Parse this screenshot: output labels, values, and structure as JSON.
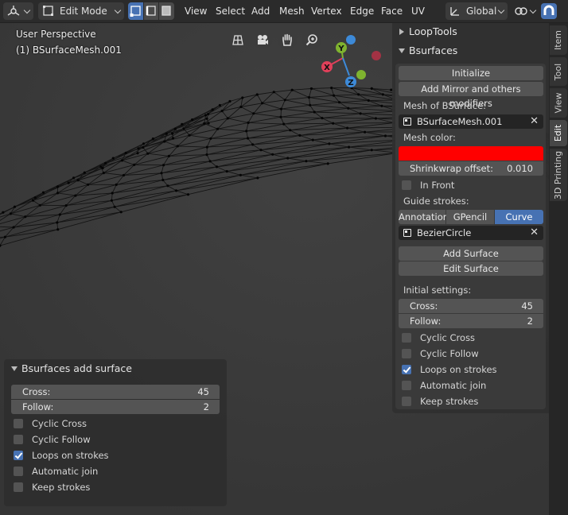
{
  "header": {
    "mode": "Edit Mode",
    "menus": [
      "View",
      "Select",
      "Add",
      "Mesh",
      "Vertex",
      "Edge",
      "Face",
      "UV"
    ],
    "transform_orientation": "Global",
    "icons": [
      "editor-type-icon",
      "vertex-select-icon",
      "edge-select-icon",
      "face-select-icon",
      "orientation-icon",
      "link-icon",
      "snap-magnet-icon"
    ]
  },
  "viewport": {
    "perspective_label": "User Perspective",
    "object_label": "(1) BSurfaceMesh.001",
    "gizmo": {
      "x": "X",
      "y": "Y",
      "z": "Z"
    },
    "nav_icons": [
      "grid-view-icon",
      "camera-icon",
      "pan-hand-icon",
      "zoom-icon"
    ]
  },
  "side_tabs": [
    {
      "label": "Item",
      "active": false
    },
    {
      "label": "Tool",
      "active": false
    },
    {
      "label": "View",
      "active": false
    },
    {
      "label": "Edit",
      "active": true
    },
    {
      "label": "3D Printing",
      "active": false
    }
  ],
  "npanel": {
    "looptools_title": "LoopTools",
    "bsurfaces_title": "Bsurfaces",
    "initialize": "Initialize",
    "add_mirror": "Add Mirror and others modifiers",
    "mesh_label": "Mesh of BSurface:",
    "mesh_value": "BSurfaceMesh.001",
    "color_label": "Mesh color:",
    "mesh_color": "#ff0000",
    "shrinkwrap_label": "Shrinkwrap offset:",
    "shrinkwrap_value": "0.010",
    "in_front": "In Front",
    "guide_label": "Guide strokes:",
    "guide_tabs": [
      {
        "label": "Annotation",
        "active": false
      },
      {
        "label": "GPencil",
        "active": false
      },
      {
        "label": "Curve",
        "active": true
      }
    ],
    "curve_value": "BezierCircle",
    "add_surface": "Add Surface",
    "edit_surface": "Edit Surface",
    "initial_label": "Initial settings:",
    "cross_label": "Cross:",
    "cross_value": "45",
    "follow_label": "Follow:",
    "follow_value": "2",
    "options": [
      {
        "label": "Cyclic Cross",
        "checked": false
      },
      {
        "label": "Cyclic Follow",
        "checked": false
      },
      {
        "label": "Loops on strokes",
        "checked": true
      },
      {
        "label": "Automatic join",
        "checked": false
      },
      {
        "label": "Keep strokes",
        "checked": false
      }
    ]
  },
  "operator": {
    "title": "Bsurfaces add surface",
    "cross_label": "Cross:",
    "cross_value": "45",
    "follow_label": "Follow:",
    "follow_value": "2",
    "options": [
      {
        "label": "Cyclic Cross",
        "checked": false
      },
      {
        "label": "Cyclic Follow",
        "checked": false
      },
      {
        "label": "Loops on strokes",
        "checked": true
      },
      {
        "label": "Automatic join",
        "checked": false
      },
      {
        "label": "Keep strokes",
        "checked": false
      }
    ]
  },
  "colors": {
    "accent": "#4772b3",
    "gizmo_x": "#e0405a",
    "gizmo_y": "#7fb32f",
    "gizmo_z": "#3d8ad8"
  }
}
